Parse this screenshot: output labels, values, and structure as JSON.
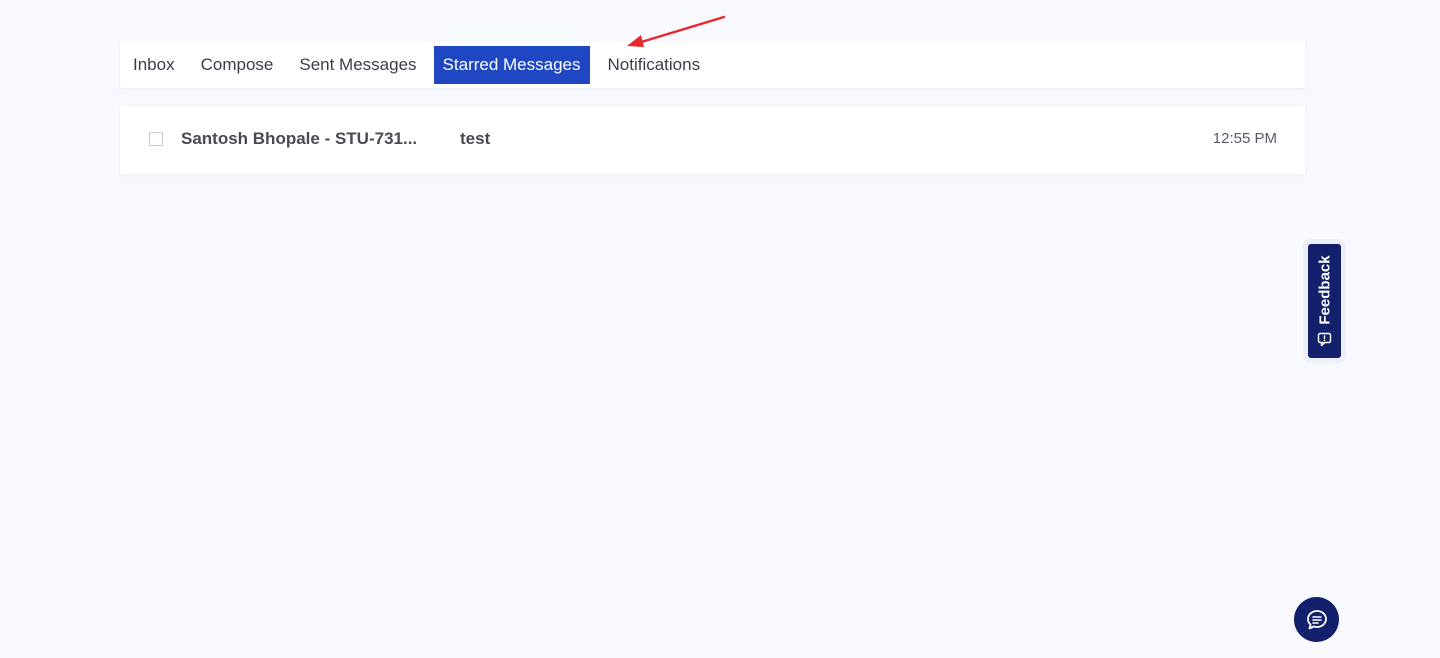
{
  "tabs": [
    {
      "label": "Inbox",
      "active": false
    },
    {
      "label": "Compose",
      "active": false
    },
    {
      "label": "Sent Messages",
      "active": false
    },
    {
      "label": "Starred Messages",
      "active": true
    },
    {
      "label": "Notifications",
      "active": false
    }
  ],
  "messages": [
    {
      "sender": "Santosh Bhopale - STU-731...",
      "subject": "test",
      "time": "12:55 PM"
    }
  ],
  "feedback": {
    "label": "Feedback",
    "icon": "feedback-icon"
  },
  "chat": {
    "icon": "chat-bubble-icon"
  },
  "colors": {
    "background": "#f8f9fe",
    "active_tab": "#1f47c4",
    "feedback_bg": "#13206b",
    "annotation_arrow": "#e8262b"
  }
}
